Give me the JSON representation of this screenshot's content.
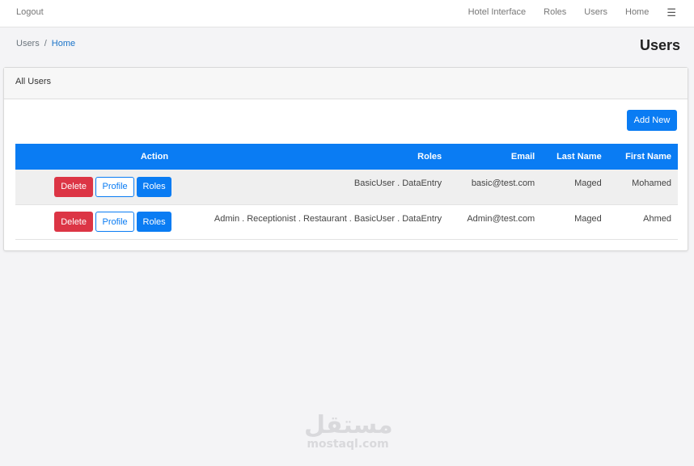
{
  "nav": {
    "logout": "Logout",
    "items": [
      "Hotel Interface",
      "Roles",
      "Users",
      "Home"
    ],
    "menu_icon": "☰"
  },
  "breadcrumb": {
    "users": "Users",
    "separator": "/",
    "home": "Home"
  },
  "page_title": "Users",
  "card": {
    "header": "All Users",
    "add_new": "Add New"
  },
  "table": {
    "headers": {
      "action": "Action",
      "roles": "Roles",
      "email": "Email",
      "last_name": "Last Name",
      "first_name": "First Name"
    },
    "rows": [
      {
        "first_name": "Mohamed",
        "last_name": "Maged",
        "email": "basic@test.com",
        "roles": "BasicUser . DataEntry",
        "delete": "Delete",
        "profile": "Profile",
        "roles_btn": "Roles"
      },
      {
        "first_name": "Ahmed",
        "last_name": "Maged",
        "email": "Admin@test.com",
        "roles": "Admin . Receptionist . Restaurant . BasicUser . DataEntry",
        "delete": "Delete",
        "profile": "Profile",
        "roles_btn": "Roles"
      }
    ]
  },
  "watermark": {
    "arabic": "مستقل",
    "latin": "mostaql.com"
  },
  "colors": {
    "primary": "#0a7cf3",
    "danger": "#dc3545",
    "background": "#f4f4f6"
  }
}
